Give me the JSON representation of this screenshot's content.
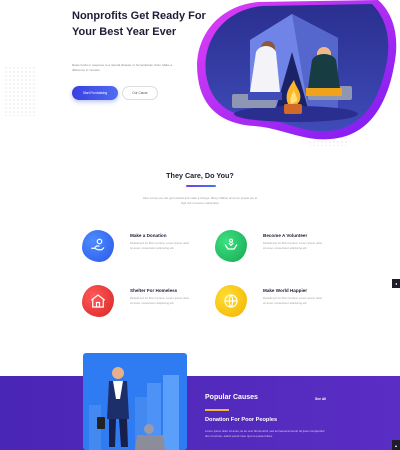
{
  "hero": {
    "title": "Nonprofits Get Ready For Your Best Year Ever",
    "description": "Raise funds in response to a natural disaster or humanitarian crisis. Make a difference in minutes.",
    "primary_button": "Start Fundraising",
    "secondary_button": "Our Cause"
  },
  "care": {
    "title": "They Care, Do You?",
    "description": "Here is how you can get involved and make a change. Many children and poor people are at high risk of severe malnutrition"
  },
  "features": [
    {
      "title": "Make a Donation",
      "description": "Default text for Box Content. Lorem Ipsum dolor sit amet, consectetur adipiscing elit.",
      "icon": "donation-hand-icon",
      "color": "#2f6ff2"
    },
    {
      "title": "Become A Volunteer",
      "description": "Default text for Box Content. Lorem Ipsum dolor sit amet, consectetur adipiscing elit.",
      "icon": "volunteer-hands-icon",
      "color": "#22c46a"
    },
    {
      "title": "Shelter For Homeless",
      "description": "Default text for Box Content. Lorem Ipsum dolor sit amet, consectetur adipiscing elit.",
      "icon": "shelter-house-icon",
      "color": "#ef3b3b"
    },
    {
      "title": "Make World Happier",
      "description": "Default text for Box Content. Lorem Ipsum dolor sit amet, consectetur adipiscing elit.",
      "icon": "globe-icon",
      "color": "#f6c40f"
    }
  ],
  "side_buttons": [
    "◂",
    "▴"
  ],
  "causes": {
    "section_title": "Popular Causes",
    "see_all": "See All",
    "cause_name": "Donation For Poor Peoples",
    "cause_description": "Lorem ipsum dolor sit amet, sit an ocer bfonil elorili, sed am laorsonmorenti. Et justo complectitur duo id soil leo, aderis possit mea. Quo te posse lotiore."
  },
  "colors": {
    "accent_blue": "#3a3fe0",
    "purple_section": "#4a26b5",
    "blob_magenta": "#c21bf0",
    "title_dark": "#1d1d35"
  }
}
